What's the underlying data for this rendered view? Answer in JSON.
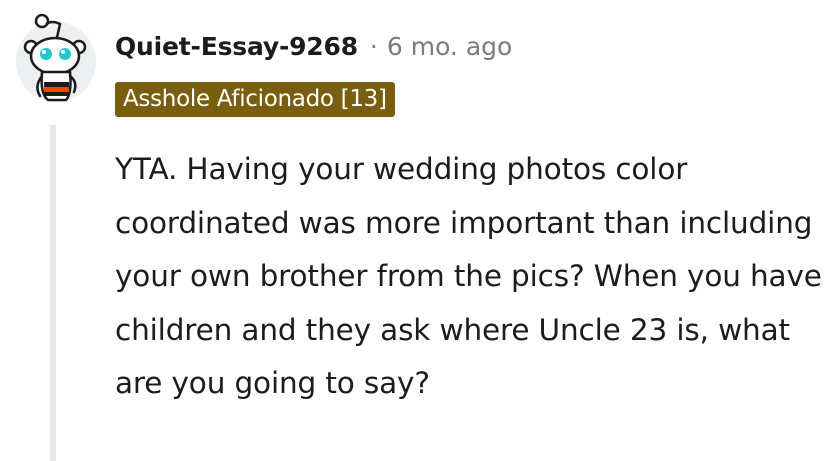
{
  "comment": {
    "username": "Quiet-Essay-9268",
    "separator": "·",
    "timestamp": "6 mo. ago",
    "flair": "Asshole Aficionado [13]",
    "body": "YTA. Having your wedding photos color coordinated was more important than including your own brother from the pics? When you have children and they ask where Uncle 23 is, what are you going to say?"
  },
  "colors": {
    "flair_background": "#7a5e0f",
    "meta_text": "#7c7c7c",
    "thread_line": "#e6e6e6",
    "avatar_accent": "#1fc9c9",
    "avatar_shirt": "#ff4500"
  },
  "icons": {
    "avatar": "snoo-avatar-icon"
  }
}
